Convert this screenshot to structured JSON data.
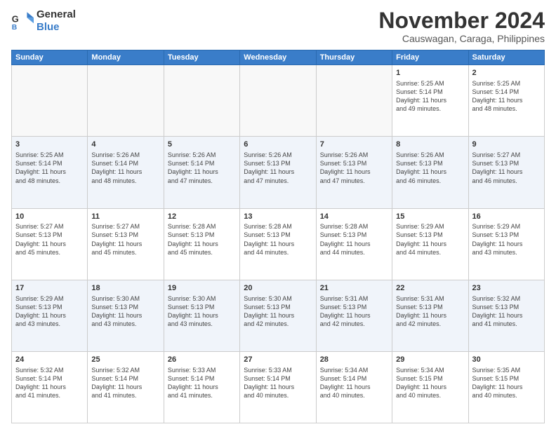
{
  "logo": {
    "line1": "General",
    "line2": "Blue"
  },
  "title": "November 2024",
  "subtitle": "Causwagan, Caraga, Philippines",
  "days_of_week": [
    "Sunday",
    "Monday",
    "Tuesday",
    "Wednesday",
    "Thursday",
    "Friday",
    "Saturday"
  ],
  "weeks": [
    [
      {
        "day": "",
        "info": ""
      },
      {
        "day": "",
        "info": ""
      },
      {
        "day": "",
        "info": ""
      },
      {
        "day": "",
        "info": ""
      },
      {
        "day": "",
        "info": ""
      },
      {
        "day": "1",
        "info": "Sunrise: 5:25 AM\nSunset: 5:14 PM\nDaylight: 11 hours\nand 49 minutes."
      },
      {
        "day": "2",
        "info": "Sunrise: 5:25 AM\nSunset: 5:14 PM\nDaylight: 11 hours\nand 48 minutes."
      }
    ],
    [
      {
        "day": "3",
        "info": "Sunrise: 5:25 AM\nSunset: 5:14 PM\nDaylight: 11 hours\nand 48 minutes."
      },
      {
        "day": "4",
        "info": "Sunrise: 5:26 AM\nSunset: 5:14 PM\nDaylight: 11 hours\nand 48 minutes."
      },
      {
        "day": "5",
        "info": "Sunrise: 5:26 AM\nSunset: 5:14 PM\nDaylight: 11 hours\nand 47 minutes."
      },
      {
        "day": "6",
        "info": "Sunrise: 5:26 AM\nSunset: 5:13 PM\nDaylight: 11 hours\nand 47 minutes."
      },
      {
        "day": "7",
        "info": "Sunrise: 5:26 AM\nSunset: 5:13 PM\nDaylight: 11 hours\nand 47 minutes."
      },
      {
        "day": "8",
        "info": "Sunrise: 5:26 AM\nSunset: 5:13 PM\nDaylight: 11 hours\nand 46 minutes."
      },
      {
        "day": "9",
        "info": "Sunrise: 5:27 AM\nSunset: 5:13 PM\nDaylight: 11 hours\nand 46 minutes."
      }
    ],
    [
      {
        "day": "10",
        "info": "Sunrise: 5:27 AM\nSunset: 5:13 PM\nDaylight: 11 hours\nand 45 minutes."
      },
      {
        "day": "11",
        "info": "Sunrise: 5:27 AM\nSunset: 5:13 PM\nDaylight: 11 hours\nand 45 minutes."
      },
      {
        "day": "12",
        "info": "Sunrise: 5:28 AM\nSunset: 5:13 PM\nDaylight: 11 hours\nand 45 minutes."
      },
      {
        "day": "13",
        "info": "Sunrise: 5:28 AM\nSunset: 5:13 PM\nDaylight: 11 hours\nand 44 minutes."
      },
      {
        "day": "14",
        "info": "Sunrise: 5:28 AM\nSunset: 5:13 PM\nDaylight: 11 hours\nand 44 minutes."
      },
      {
        "day": "15",
        "info": "Sunrise: 5:29 AM\nSunset: 5:13 PM\nDaylight: 11 hours\nand 44 minutes."
      },
      {
        "day": "16",
        "info": "Sunrise: 5:29 AM\nSunset: 5:13 PM\nDaylight: 11 hours\nand 43 minutes."
      }
    ],
    [
      {
        "day": "17",
        "info": "Sunrise: 5:29 AM\nSunset: 5:13 PM\nDaylight: 11 hours\nand 43 minutes."
      },
      {
        "day": "18",
        "info": "Sunrise: 5:30 AM\nSunset: 5:13 PM\nDaylight: 11 hours\nand 43 minutes."
      },
      {
        "day": "19",
        "info": "Sunrise: 5:30 AM\nSunset: 5:13 PM\nDaylight: 11 hours\nand 43 minutes."
      },
      {
        "day": "20",
        "info": "Sunrise: 5:30 AM\nSunset: 5:13 PM\nDaylight: 11 hours\nand 42 minutes."
      },
      {
        "day": "21",
        "info": "Sunrise: 5:31 AM\nSunset: 5:13 PM\nDaylight: 11 hours\nand 42 minutes."
      },
      {
        "day": "22",
        "info": "Sunrise: 5:31 AM\nSunset: 5:13 PM\nDaylight: 11 hours\nand 42 minutes."
      },
      {
        "day": "23",
        "info": "Sunrise: 5:32 AM\nSunset: 5:13 PM\nDaylight: 11 hours\nand 41 minutes."
      }
    ],
    [
      {
        "day": "24",
        "info": "Sunrise: 5:32 AM\nSunset: 5:14 PM\nDaylight: 11 hours\nand 41 minutes."
      },
      {
        "day": "25",
        "info": "Sunrise: 5:32 AM\nSunset: 5:14 PM\nDaylight: 11 hours\nand 41 minutes."
      },
      {
        "day": "26",
        "info": "Sunrise: 5:33 AM\nSunset: 5:14 PM\nDaylight: 11 hours\nand 41 minutes."
      },
      {
        "day": "27",
        "info": "Sunrise: 5:33 AM\nSunset: 5:14 PM\nDaylight: 11 hours\nand 40 minutes."
      },
      {
        "day": "28",
        "info": "Sunrise: 5:34 AM\nSunset: 5:14 PM\nDaylight: 11 hours\nand 40 minutes."
      },
      {
        "day": "29",
        "info": "Sunrise: 5:34 AM\nSunset: 5:15 PM\nDaylight: 11 hours\nand 40 minutes."
      },
      {
        "day": "30",
        "info": "Sunrise: 5:35 AM\nSunset: 5:15 PM\nDaylight: 11 hours\nand 40 minutes."
      }
    ]
  ]
}
